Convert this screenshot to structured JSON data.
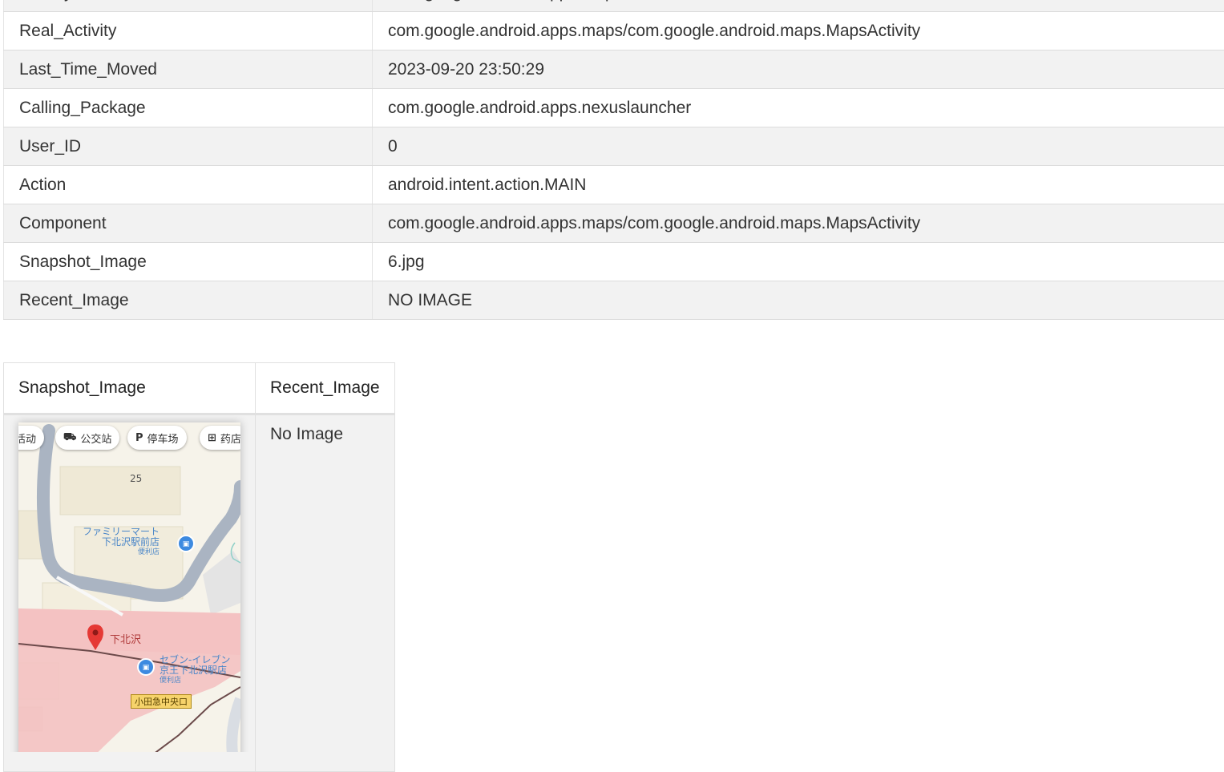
{
  "properties": [
    {
      "key": "Activity",
      "value": "com.google.android.apps.maps"
    },
    {
      "key": "Real_Activity",
      "value": "com.google.android.apps.maps/com.google.android.maps.MapsActivity"
    },
    {
      "key": "Last_Time_Moved",
      "value": "2023-09-20 23:50:29"
    },
    {
      "key": "Calling_Package",
      "value": "com.google.android.apps.nexuslauncher"
    },
    {
      "key": "User_ID",
      "value": "0"
    },
    {
      "key": "Action",
      "value": "android.intent.action.MAIN"
    },
    {
      "key": "Component",
      "value": "com.google.android.apps.maps/com.google.android.maps.MapsActivity"
    },
    {
      "key": "Snapshot_Image",
      "value": "6.jpg"
    },
    {
      "key": "Recent_Image",
      "value": "NO IMAGE"
    }
  ],
  "images_table": {
    "headers": [
      "Snapshot_Image",
      "Recent_Image"
    ],
    "recent_value": "No Image"
  },
  "snapshot": {
    "chips": [
      {
        "icon": "",
        "label": "活动"
      },
      {
        "icon": "⛟",
        "label": "公交站"
      },
      {
        "icon": "P",
        "label": "停车场"
      },
      {
        "icon": "⊞",
        "label": "药店"
      }
    ],
    "block_number": "25",
    "poi1": {
      "name1": "ファミリーマート",
      "name2": "下北沢駅前店",
      "category": "便利店"
    },
    "station": "下北沢",
    "poi2": {
      "name1": "セブン-イレブン",
      "name2": "京王下北沢駅店",
      "category": "便利店"
    },
    "exit_label": "小田急中央口"
  },
  "colors": {
    "row_stripe": "#f2f2f2",
    "map_road": "#aab4c2",
    "map_station_area": "#f4c2c2",
    "pin": "#e53935",
    "poi": "#3d8ae0"
  }
}
